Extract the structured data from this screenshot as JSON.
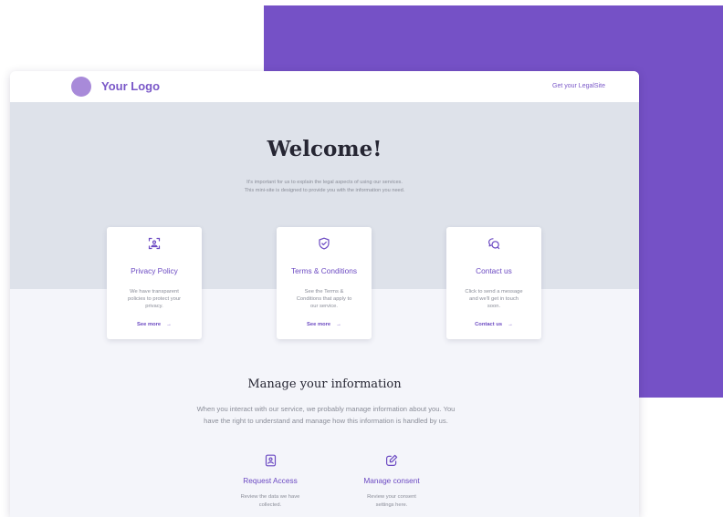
{
  "header": {
    "logo_text": "Your Logo",
    "nav_link": "Get your LegalSite"
  },
  "hero": {
    "title": "Welcome!",
    "subtitle_lines": [
      "It's important for us to explain the legal aspects of using our services.",
      "This mini-site is designed to provide you with the information you need."
    ]
  },
  "cards": [
    {
      "icon": "user-shield-icon",
      "title": "Privacy Policy",
      "desc_lines": [
        "We have transparent",
        "policies to protect your",
        "privacy."
      ],
      "link": "See more"
    },
    {
      "icon": "shield-check-icon",
      "title": "Terms & Conditions",
      "desc_lines": [
        "See the Terms &",
        "Conditions that apply to",
        "our service."
      ],
      "link": "See more"
    },
    {
      "icon": "chat-bubbles-icon",
      "title": "Contact us",
      "desc_lines": [
        "Click to send a message",
        "and we'll get in touch",
        "soon."
      ],
      "link": "Contact us"
    }
  ],
  "manage": {
    "title": "Manage your information",
    "subtitle_lines": [
      "When you interact with our service, we probably manage information about you. You",
      "have the right to understand and manage how this information is handled by us."
    ],
    "features": [
      {
        "icon": "id-badge-icon",
        "title": "Request Access",
        "desc_lines": [
          "Review the data we have",
          "collected."
        ]
      },
      {
        "icon": "edit-consent-icon",
        "title": "Manage consent",
        "desc_lines": [
          "Review your consent",
          "settings here."
        ]
      }
    ]
  },
  "colors": {
    "brand_purple": "#7551c6",
    "accent_text": "#6b49c2",
    "hero_bg": "#dee2ea",
    "page_bg": "#f4f5fa"
  }
}
